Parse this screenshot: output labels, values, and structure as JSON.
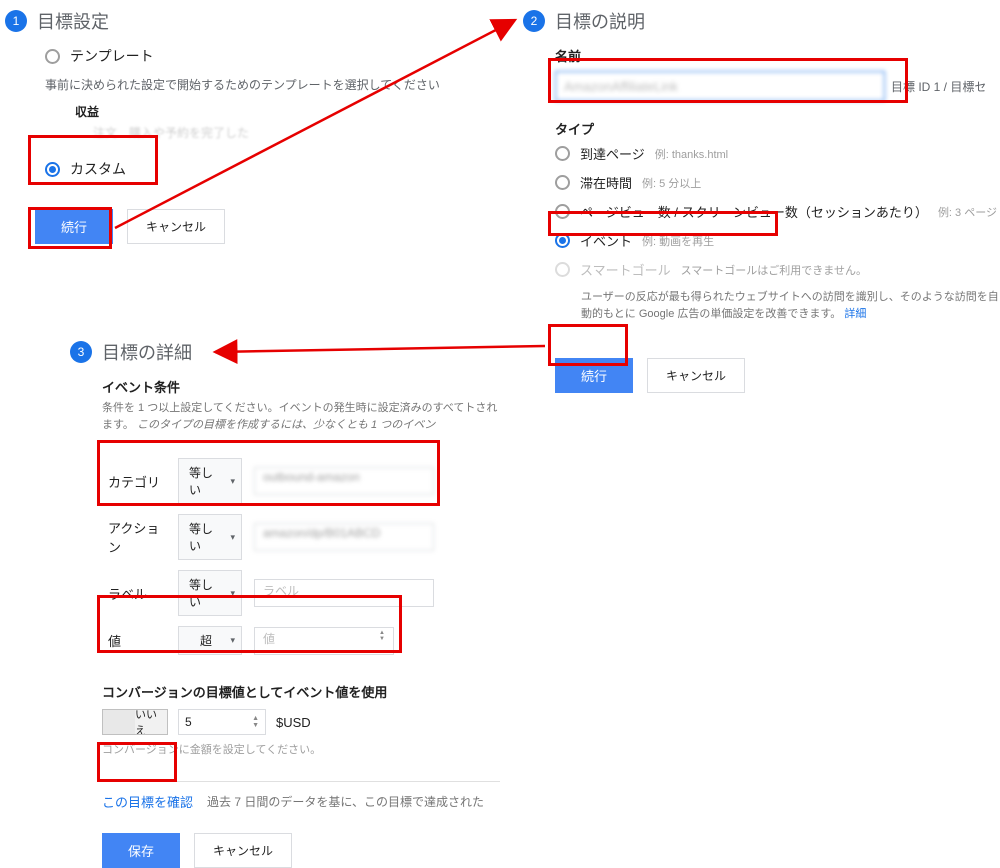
{
  "step1": {
    "badge": "1",
    "title": "目標設定",
    "template_label": "テンプレート",
    "template_help": "事前に決められた設定で開始するためのテンプレートを選択してください",
    "revenue_heading": "収益",
    "faded_row": "注文　購入や予約を完了した",
    "custom_label": "カスタム",
    "continue": "続行",
    "cancel": "キャンセル"
  },
  "step2": {
    "badge": "2",
    "title": "目標の説明",
    "name_label": "名前",
    "name_value": "AmazonAffiliateLink",
    "id_note": "目標 ID 1 / 目標セ",
    "type_label": "タイプ",
    "types": {
      "destination": {
        "label": "到達ページ",
        "eg": "例: thanks.html"
      },
      "duration": {
        "label": "滞在時間",
        "eg": "例: 5 分以上"
      },
      "pages": {
        "label": "ページビュー数 / スクリーンビュー数（セッションあたり）",
        "eg": "例: 3 ページ"
      },
      "event": {
        "label": "イベント",
        "eg": "例: 動画を再生"
      },
      "smart": {
        "label": "スマートゴール",
        "eg": "スマートゴールはご利用できません。"
      }
    },
    "smart_desc": "ユーザーの反応が最も得られたウェブサイトへの訪問を識別し、そのような訪問を自動的もとに Google 広告の単価設定を改善できます。",
    "smart_more": "詳細",
    "continue": "続行",
    "cancel": "キャンセル"
  },
  "step3": {
    "badge": "3",
    "title": "目標の詳細",
    "cond_heading": "イベント条件",
    "cond_desc_a": "条件を 1 つ以上設定してください。イベントの発生時に設定済みのすべてトされます。",
    "cond_desc_b": "このタイプの目標を作成するには、少なくとも 1 つのイベン",
    "rows": {
      "category": {
        "label": "カテゴリ",
        "op": "等しい",
        "val": "outbound-amazon"
      },
      "action": {
        "label": "アクション",
        "op": "等しい",
        "val": "amazon/dp/B01ABCD"
      },
      "label": {
        "label": "ラベル",
        "op": "等しい",
        "placeholder": "ラベル"
      },
      "value": {
        "label": "値",
        "op": "超",
        "placeholder": "値"
      }
    },
    "conv_title": "コンバージョンの目標値としてイベント値を使用",
    "toggle_no": "いいえ",
    "conv_value": "5",
    "currency": "$USD",
    "conv_help": "コンバージョンに金額を設定してください。",
    "verify_link": "この目標を確認",
    "verify_desc": "過去 7 日間のデータを基に、この目標で達成された",
    "save": "保存",
    "cancel": "キャンセル"
  }
}
